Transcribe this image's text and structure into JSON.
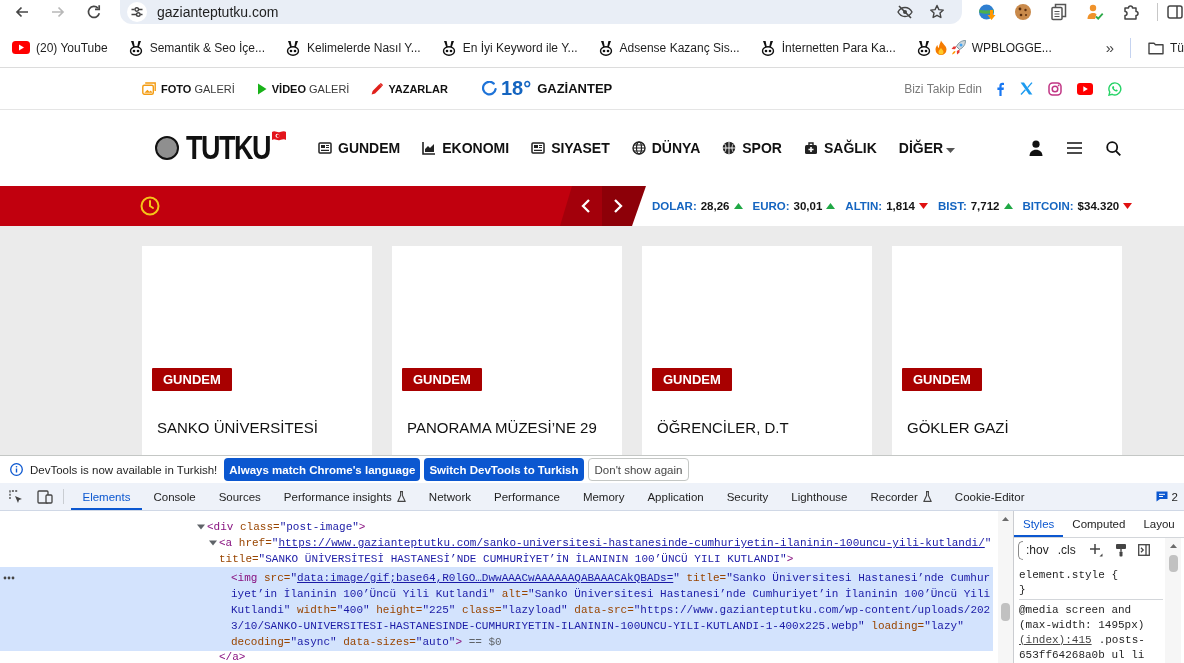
{
  "browser": {
    "nav": [
      {
        "kind": "back",
        "disabled": false
      },
      {
        "kind": "forward",
        "disabled": true
      },
      {
        "kind": "reload",
        "disabled": false
      }
    ],
    "address": "gazianteptutku.com",
    "bookmarks": [
      {
        "kind": "video",
        "title": "(20) YouTube"
      },
      {
        "kind": "site",
        "title": "Semantik & Seo İçe..."
      },
      {
        "kind": "site",
        "title": "Kelimelerde Nasıl Y..."
      },
      {
        "kind": "site",
        "title": "En İyi Keyword ile Y..."
      },
      {
        "kind": "site",
        "title": "Adsense Kazanç Sis..."
      },
      {
        "kind": "site",
        "title": "İnternetten Para Ka..."
      },
      {
        "kind": "site-emoji",
        "title": "WPBLOGGE..."
      }
    ],
    "overflow": "»",
    "folder": "Tü"
  },
  "site": {
    "topbar": {
      "links": [
        {
          "kind": "photo",
          "label": "**FOTO** GALERİ"
        },
        {
          "kind": "video",
          "label": "**VİDEO** GALERİ"
        },
        {
          "kind": "authors",
          "label": "YAZARLAR"
        }
      ],
      "weather": {
        "temperature": "18°",
        "city": "GAZİANTEP"
      },
      "follow_label": "Bizi Takip Edin"
    },
    "logo": {
      "name": "TUTKU"
    },
    "nav": [
      {
        "kind": "news",
        "label": "GUNDEM"
      },
      {
        "kind": "economy",
        "label": "EKONOMI"
      },
      {
        "kind": "politics",
        "label": "SIYASET"
      },
      {
        "kind": "world",
        "label": "DÜNYA"
      },
      {
        "kind": "sport",
        "label": "SPOR"
      },
      {
        "kind": "health",
        "label": "SAĞLIK"
      },
      {
        "kind": "more",
        "label": "DİĞER"
      }
    ],
    "rates": [
      {
        "label": "DOLAR:",
        "value": "28,26",
        "rising": true
      },
      {
        "label": "EURO:",
        "value": "30,01",
        "rising": true
      },
      {
        "label": "ALTIN:",
        "value": "1,814",
        "rising": false
      },
      {
        "label": "BIST:",
        "value": "7,712",
        "rising": true
      },
      {
        "label": "BITCOIN:",
        "value": "$34.320",
        "rising": false
      }
    ],
    "cards": [
      {
        "category": "GUNDEM",
        "title": "SANKO ÜNİVERSİTESİ"
      },
      {
        "category": "GUNDEM",
        "title": "PANORAMA MÜZESİ’NE 29"
      },
      {
        "category": "GUNDEM",
        "title": "ÖĞRENCİLER, D.T"
      },
      {
        "category": "GUNDEM",
        "title": "GÖKLER GAZİ"
      }
    ]
  },
  "devtools": {
    "infobar": {
      "message": "DevTools is now available in Turkish!",
      "buttons": [
        {
          "kind": "primary",
          "label": "Always match Chrome's language"
        },
        {
          "kind": "primary",
          "label": "Switch DevTools to Turkish"
        },
        {
          "kind": "secondary",
          "label": "Don't show again"
        }
      ]
    },
    "tabs": [
      {
        "label": "Elements",
        "selected": true,
        "experimental": false
      },
      {
        "label": "Console",
        "selected": false,
        "experimental": false
      },
      {
        "label": "Sources",
        "selected": false,
        "experimental": false
      },
      {
        "label": "Performance insights",
        "selected": false,
        "experimental": true
      },
      {
        "label": "Network",
        "selected": false,
        "experimental": false
      },
      {
        "label": "Performance",
        "selected": false,
        "experimental": false
      },
      {
        "label": "Memory",
        "selected": false,
        "experimental": false
      },
      {
        "label": "Application",
        "selected": false,
        "experimental": false
      },
      {
        "label": "Security",
        "selected": false,
        "experimental": false
      },
      {
        "label": "Lighthouse",
        "selected": false,
        "experimental": false
      },
      {
        "label": "Recorder",
        "selected": false,
        "experimental": true
      },
      {
        "label": "Cookie-Editor",
        "selected": false,
        "experimental": false
      }
    ],
    "issues_count": "2",
    "dom_tree": [
      {
        "expanded": true,
        "selected": false,
        "tokens": [
          {
            "kind": "tag",
            "text": "<div"
          },
          {
            "kind": "attr",
            "text": " class="
          },
          {
            "kind": "value",
            "text": "\"post-image\""
          },
          {
            "kind": "tag",
            "text": ">"
          }
        ],
        "children": [
          {
            "expanded": true,
            "selected": false,
            "tokens": [
              {
                "kind": "tag",
                "text": "<a"
              },
              {
                "kind": "attr",
                "text": " href="
              },
              {
                "kind": "value",
                "text": "\""
              },
              {
                "kind": "link",
                "text": "https://www.gazianteptutku.com/sanko-universitesi-hastanesinde-cumhuriyetin-ilaninin-100uncu-yili-kutlandi/"
              },
              {
                "kind": "value",
                "text": "\""
              },
              {
                "kind": "attr",
                "text": " title="
              },
              {
                "kind": "value",
                "text": "\"SANKO ÜNİVERSİTESİ HASTANESİ’NDE CUMHURİYET’İN İLANININ 100’ÜNCÜ YILI KUTLANDI\""
              },
              {
                "kind": "tag",
                "text": ">"
              }
            ],
            "children": [
              {
                "selected": true,
                "tokens": [
                  {
                    "kind": "tag",
                    "text": "<img"
                  },
                  {
                    "kind": "attr",
                    "text": " src="
                  },
                  {
                    "kind": "value",
                    "text": "\""
                  },
                  {
                    "kind": "link",
                    "text": "data:image/gif;base64,R0lGO…DwwAAACwAAAAAAQABAAACAkQBADs="
                  },
                  {
                    "kind": "value",
                    "text": "\""
                  },
                  {
                    "kind": "attr",
                    "text": " title="
                  },
                  {
                    "kind": "value",
                    "text": "\"Sanko Üniversitesi Hastanesi’nde Cumhuriyet’in İlaninin 100’Üncü Yili Kutlandi\""
                  },
                  {
                    "kind": "attr",
                    "text": " alt="
                  },
                  {
                    "kind": "value",
                    "text": "\"Sanko Üniversitesi Hastanesi’nde Cumhuriyet’in İlaninin 100’Üncü Yili Kutlandi\""
                  },
                  {
                    "kind": "attr",
                    "text": " width="
                  },
                  {
                    "kind": "value",
                    "text": "\"400\""
                  },
                  {
                    "kind": "attr",
                    "text": " height="
                  },
                  {
                    "kind": "value",
                    "text": "\"225\""
                  },
                  {
                    "kind": "attr",
                    "text": " class="
                  },
                  {
                    "kind": "value",
                    "text": "\"lazyload\""
                  },
                  {
                    "kind": "attr",
                    "text": " data-src="
                  },
                  {
                    "kind": "value",
                    "text": "\"https://www.gazianteptutku.com/wp-content/uploads/2023/10/SANKO-UNIVERSITESI-HASTANESINDE-CUMHURIYETIN-ILANININ-100UNCU-YILI-KUTLANDI-1-400x225.webp\""
                  },
                  {
                    "kind": "attr",
                    "text": " loading="
                  },
                  {
                    "kind": "value",
                    "text": "\"lazy\""
                  },
                  {
                    "kind": "attr",
                    "text": " decoding="
                  },
                  {
                    "kind": "value",
                    "text": "\"async\""
                  },
                  {
                    "kind": "attr",
                    "text": " data-sizes="
                  },
                  {
                    "kind": "value",
                    "text": "\"auto\""
                  },
                  {
                    "kind": "tag",
                    "text": ">"
                  },
                  {
                    "kind": "marker",
                    "text": " == $0"
                  }
                ]
              }
            ],
            "closing": "</a>"
          }
        ]
      }
    ],
    "styles_pane": {
      "tabs": [
        {
          "label": "Styles",
          "selected": true
        },
        {
          "label": "Computed",
          "selected": false
        },
        {
          "label": "Layou",
          "selected": false
        }
      ],
      "toggles": [
        ":hov",
        ".cls"
      ],
      "rules": [
        {
          "selector": "element.style {",
          "closing": "}"
        },
        {
          "media": "@media screen and (max-width: 1495px)",
          "selector": ".posts-653ff64268a0b ul li",
          "source": "(index):415"
        }
      ]
    }
  }
}
